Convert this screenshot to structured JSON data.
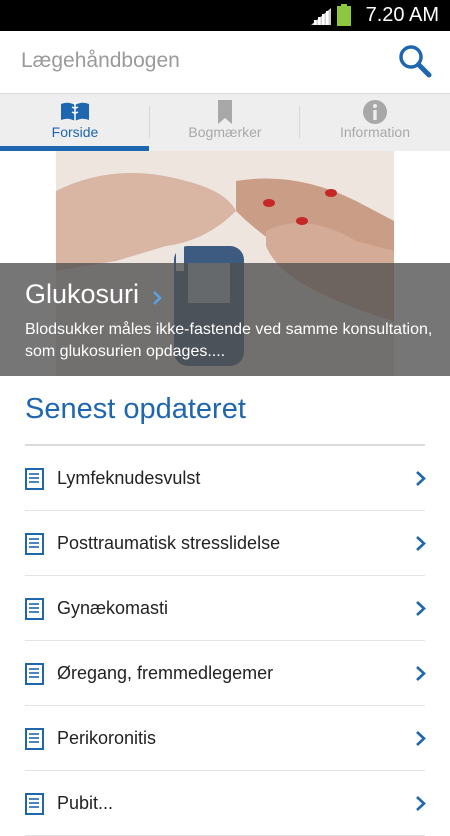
{
  "status_bar": {
    "time": "7.20 AM"
  },
  "app_bar": {
    "title": "Lægehåndbogen"
  },
  "tabs": [
    {
      "label": "Forside",
      "icon": "book-icon",
      "active": true
    },
    {
      "label": "Bogmærker",
      "icon": "bookmark-icon",
      "active": false
    },
    {
      "label": "Information",
      "icon": "info-icon",
      "active": false
    }
  ],
  "featured": {
    "title": "Glukosuri",
    "text": "Blodsukker måles ikke-fastende ved samme konsultation, som glukosurien opdages...."
  },
  "recent": {
    "heading": "Senest opdateret",
    "items": [
      {
        "label": "Lymfeknudesvulst"
      },
      {
        "label": "Posttraumatisk stresslidelse"
      },
      {
        "label": "Gynækomasti"
      },
      {
        "label": "Øregang, fremmedlegemer"
      },
      {
        "label": "Perikoronitis"
      },
      {
        "label": "Pubit..."
      }
    ]
  },
  "colors": {
    "accent": "#1f66b0",
    "tab_bg": "#eeeeee",
    "status_bar": "#000000",
    "battery": "#8dc63f"
  }
}
